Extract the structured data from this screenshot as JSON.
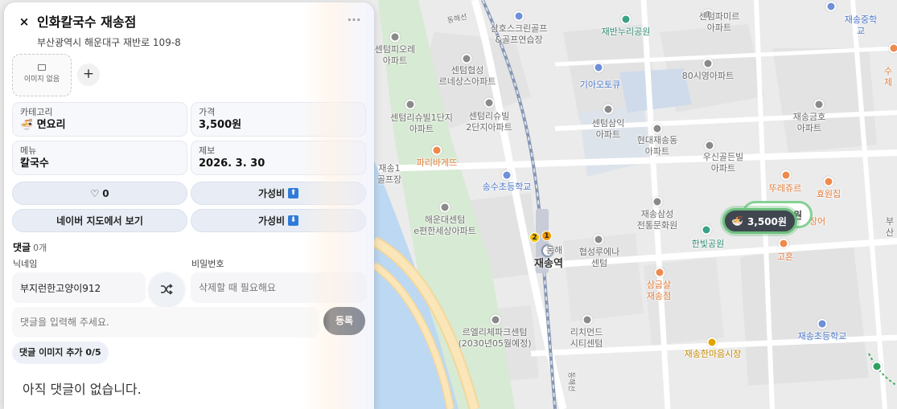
{
  "panel": {
    "title": "인화칼국수 재송점",
    "address": "부산광역시 해운대구 재반로 109-8",
    "image_empty_label": "이미지 없음",
    "image_add_symbol": "+",
    "close_symbol": "×",
    "more_symbol": "···",
    "info": {
      "category_label": "카테고리",
      "category_icon": "🍜",
      "category_value": "면요리",
      "price_label": "가격",
      "price_value": "3,500원",
      "menu_label": "메뉴",
      "menu_value": "칼국수",
      "reported_label": "제보",
      "reported_value": "2026. 3. 30"
    },
    "actions": {
      "like_count": "0",
      "value_up_label": "가성비",
      "value_up_badge": "⬆",
      "naver_map_label": "네이버 지도에서 보기",
      "value_down_label": "가성비",
      "value_down_badge": "⬇"
    },
    "comments": {
      "title": "댓글",
      "count": "0개",
      "nickname_label": "닉네임",
      "nickname_value": "부지런한고양이912",
      "password_label": "비밀번호",
      "password_placeholder": "삭제할 때 필요해요",
      "comment_placeholder": "댓글을 입력해 주세요.",
      "submit_label": "등록",
      "add_image_label": "댓글 이미지 추가 0/5",
      "empty_message": "아직 댓글이 없습니다."
    }
  },
  "map": {
    "labels": [
      {
        "name": "samho-golf",
        "text": "삼호스크린골프\n&골프연습장",
        "color": "grey"
      },
      {
        "name": "jaeban-park",
        "text": "재반누리공원",
        "color": "teal"
      },
      {
        "name": "centum-family",
        "text": "센텀파미르\n아파트",
        "color": "grey"
      },
      {
        "name": "jaesong-middle",
        "text": "재송중학교",
        "color": "blue"
      },
      {
        "name": "centum-piore",
        "text": "센텀피오레\n아파트",
        "color": "grey"
      },
      {
        "name": "centum-hyeopseong",
        "text": "센텀협성\n르네상스아파트",
        "color": "grey"
      },
      {
        "name": "kia-autoq",
        "text": "기아오토큐",
        "color": "blue"
      },
      {
        "name": "80si-apt",
        "text": "80시영아파트",
        "color": "grey"
      },
      {
        "name": "centum-richville1",
        "text": "센텀리슈빌1단지\n아파트",
        "color": "grey"
      },
      {
        "name": "centum-richville2",
        "text": "센텀리슈빌\n2단지아파트",
        "color": "grey"
      },
      {
        "name": "centum-samik",
        "text": "센텀삼익\n아파트",
        "color": "grey"
      },
      {
        "name": "jaesong-geumho",
        "text": "재송금호\n아파트",
        "color": "grey"
      },
      {
        "name": "hyundai-jaesong",
        "text": "현대재송동\n아파트",
        "color": "grey"
      },
      {
        "name": "paris-baguette",
        "text": "파리바게뜨",
        "color": "orange"
      },
      {
        "name": "usin-golden",
        "text": "우신골든빌\n아파트",
        "color": "grey"
      },
      {
        "name": "jaesong1",
        "text": "재송1\n골프장",
        "color": "grey"
      },
      {
        "name": "songsu-elem",
        "text": "송수초등학교",
        "color": "blue"
      },
      {
        "name": "tous-jours",
        "text": "뚜레쥬르",
        "color": "orange"
      },
      {
        "name": "hyowon",
        "text": "효원집",
        "color": "orange"
      },
      {
        "name": "haeundae-centum",
        "text": "해운대센텀\ne편한세상아파트",
        "color": "grey"
      },
      {
        "name": "jaesong-samsung",
        "text": "재송삼성\n전통문화원",
        "color": "grey"
      },
      {
        "name": "hanbit-park",
        "text": "한빛공원",
        "color": "teal"
      },
      {
        "name": "jangeo",
        "text": "장어",
        "color": "orange"
      },
      {
        "name": "busan-right",
        "text": "부산",
        "color": "grey"
      },
      {
        "name": "donghae-line",
        "text": "동해",
        "color": "grey"
      },
      {
        "name": "jaesong-station",
        "text": "재송역",
        "color": "dark"
      },
      {
        "name": "hyeopseong-renai",
        "text": "협성루에나\n센텀",
        "color": "grey"
      },
      {
        "name": "gohon",
        "text": "고혼",
        "color": "orange"
      },
      {
        "name": "samgeupsal",
        "text": "삼굽살\n재송점",
        "color": "orange"
      },
      {
        "name": "le-eliche",
        "text": "르엘리체파크센텀\n(2030년05월예정)",
        "color": "grey"
      },
      {
        "name": "richmond",
        "text": "리치먼드\n시티센텀",
        "color": "grey"
      },
      {
        "name": "jaesong-elem",
        "text": "재송초등학교",
        "color": "blue"
      },
      {
        "name": "jaesong-market",
        "text": "재송한마음시장",
        "color": "gold"
      },
      {
        "name": "donghae-line-top",
        "text": "동해선",
        "color": "grey"
      },
      {
        "name": "donghae-line-bottom",
        "text": "동해선",
        "color": "grey"
      },
      {
        "name": "sudo",
        "text": "수제",
        "color": "orange"
      }
    ],
    "price_marker": {
      "icon": "🍜",
      "label": "3,500원"
    },
    "price_marker_behind": {
      "label": "원"
    },
    "line_badges": [
      "2",
      "1"
    ]
  }
}
